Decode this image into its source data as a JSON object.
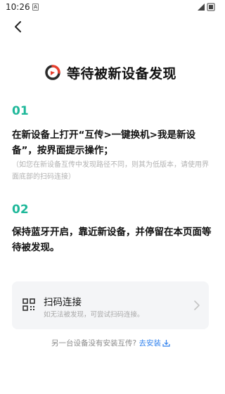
{
  "status": {
    "time": "10:26",
    "notification_glyph": "A"
  },
  "nav": {
    "back_icon": "back-arrow-icon"
  },
  "header": {
    "logo_icon": "app-logo-icon",
    "title": "等待被新设备发现"
  },
  "steps": [
    {
      "number": "01",
      "text": "在新设备上打开“互传>一键换机>我是新设备”，按界面提示操作；",
      "hint": "（如您在新设备互传中发现路径不同，则其为低版本，请使用界面底部的扫码连接）"
    },
    {
      "number": "02",
      "text": "保持蓝牙开启，靠近新设备，并停留在本页面等待被发现。"
    }
  ],
  "scan_card": {
    "icon": "qr-scan-icon",
    "title": "扫码连接",
    "subtitle": "如无法被发现，可尝试扫码连接。",
    "chevron_icon": "chevron-right-icon"
  },
  "footer": {
    "prompt": "另一台设备没有安装互传?",
    "link": "去安装",
    "link_icon": "download-icon"
  },
  "colors": {
    "accent": "#1fb89a",
    "link": "#2f80ed",
    "logo_red": "#e8402f",
    "logo_dark": "#2b2b2b"
  }
}
